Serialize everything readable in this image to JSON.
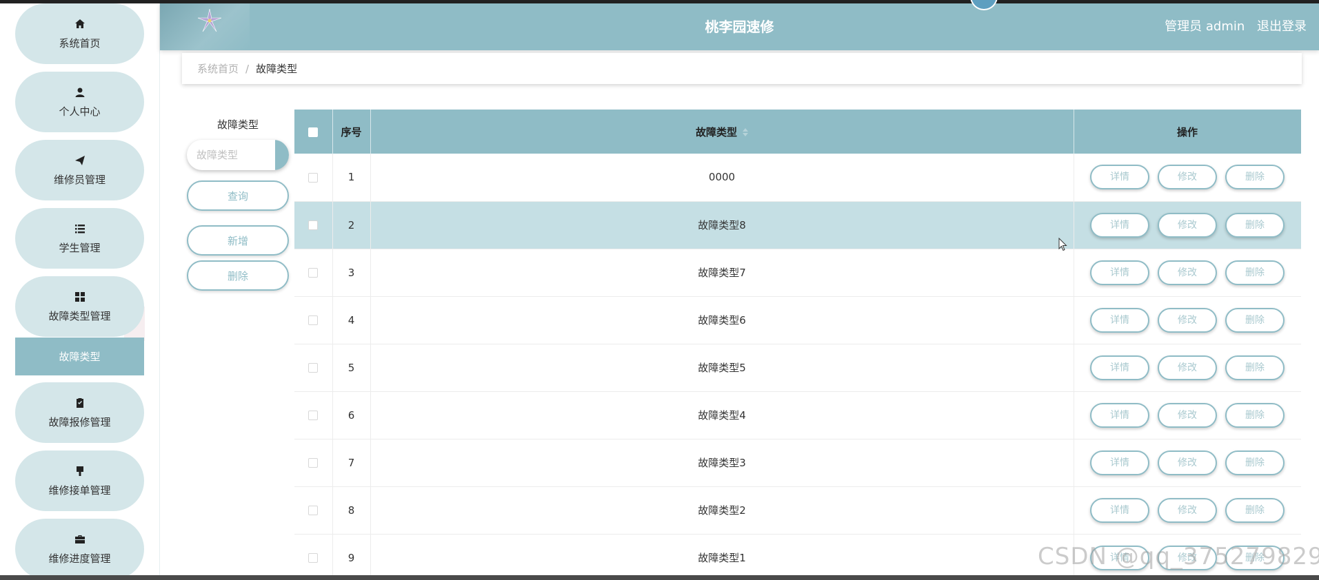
{
  "header": {
    "title": "桃李园速修",
    "user_label": "管理员 admin",
    "logout_label": "退出登录"
  },
  "sidebar": {
    "items": [
      {
        "label": "系统首页",
        "icon": "home-icon"
      },
      {
        "label": "个人中心",
        "icon": "user-icon"
      },
      {
        "label": "维修员管理",
        "icon": "send-icon"
      },
      {
        "label": "学生管理",
        "icon": "list-icon"
      },
      {
        "label": "故障类型管理",
        "icon": "grid-icon"
      },
      {
        "label": "故障报修管理",
        "icon": "clipboard-icon"
      },
      {
        "label": "维修接单管理",
        "icon": "brush-icon"
      },
      {
        "label": "维修进度管理",
        "icon": "briefcase-icon"
      }
    ],
    "active_sub": "故障类型"
  },
  "breadcrumb": {
    "home": "系统首页",
    "separator": "/",
    "current": "故障类型"
  },
  "search": {
    "label": "故障类型",
    "placeholder": "故障类型",
    "query_label": "查询",
    "add_label": "新增",
    "delete_label": "删除"
  },
  "table": {
    "headers": {
      "index": "序号",
      "type": "故障类型",
      "actions": "操作"
    },
    "rows": [
      {
        "index": "1",
        "type": "0000"
      },
      {
        "index": "2",
        "type": "故障类型8"
      },
      {
        "index": "3",
        "type": "故障类型7"
      },
      {
        "index": "4",
        "type": "故障类型6"
      },
      {
        "index": "5",
        "type": "故障类型5"
      },
      {
        "index": "6",
        "type": "故障类型4"
      },
      {
        "index": "7",
        "type": "故障类型3"
      },
      {
        "index": "8",
        "type": "故障类型2"
      },
      {
        "index": "9",
        "type": "故障类型1"
      }
    ],
    "actions": {
      "detail": "详情",
      "edit": "修改",
      "delete": "删除"
    }
  },
  "watermark": "CSDN @qq_375279829",
  "colors": {
    "accent": "#8fbcc6",
    "nav_bg": "#d4e6e9",
    "highlight_row": "#c5dfe4"
  }
}
